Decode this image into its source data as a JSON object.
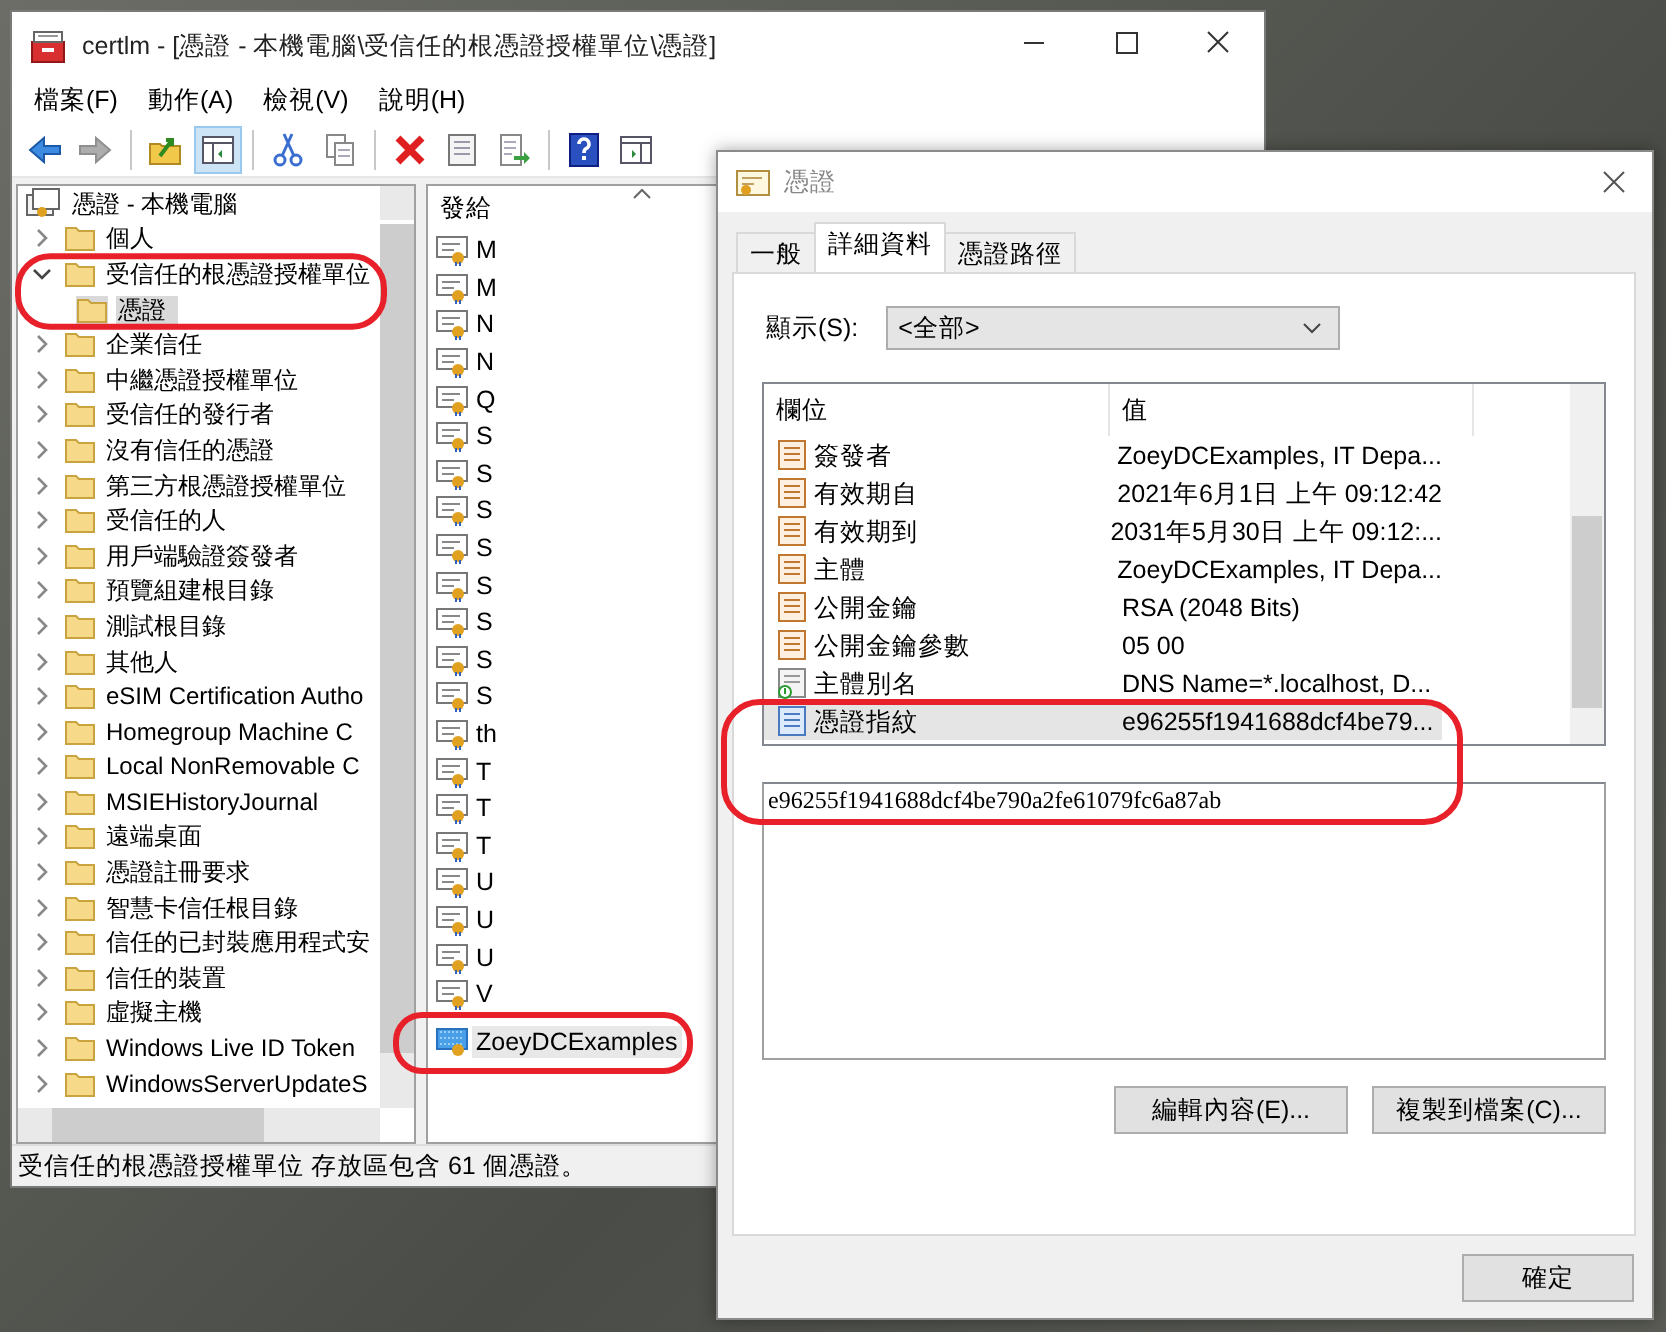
{
  "window": {
    "title": "certlm - [憑證 - 本機電腦\\受信任的根憑證授權單位\\憑證]"
  },
  "menu": [
    "檔案(F)",
    "動作(A)",
    "檢視(V)",
    "說明(H)"
  ],
  "toolbar": {
    "groups": [
      {
        "buttons": [
          {
            "kind": "back",
            "disabled": false,
            "pressed": false
          },
          {
            "kind": "forward",
            "disabled": true,
            "pressed": false
          }
        ]
      },
      {
        "buttons": [
          {
            "kind": "folder-up",
            "disabled": false,
            "pressed": false
          },
          {
            "kind": "console-tree",
            "disabled": false,
            "pressed": true
          }
        ]
      },
      {
        "buttons": [
          {
            "kind": "cut",
            "disabled": false,
            "pressed": false
          },
          {
            "kind": "copy",
            "disabled": false,
            "pressed": false
          }
        ]
      },
      {
        "buttons": [
          {
            "kind": "delete",
            "disabled": false,
            "pressed": false
          },
          {
            "kind": "properties",
            "disabled": false,
            "pressed": false
          },
          {
            "kind": "export",
            "disabled": false,
            "pressed": false
          }
        ]
      },
      {
        "buttons": [
          {
            "kind": "help",
            "disabled": false,
            "pressed": false
          },
          {
            "kind": "action-pane",
            "disabled": false,
            "pressed": false
          }
        ]
      }
    ]
  },
  "tree": {
    "root": "憑證 - 本機電腦",
    "items": [
      {
        "label": "個人",
        "expanded": false,
        "selected": false
      },
      {
        "label": "受信任的根憑證授權單位",
        "expanded": true,
        "selected": false,
        "children": [
          {
            "label": "憑證",
            "selected": true
          }
        ]
      },
      {
        "label": "企業信任",
        "expanded": false,
        "selected": false
      },
      {
        "label": "中繼憑證授權單位",
        "expanded": false,
        "selected": false
      },
      {
        "label": "受信任的發行者",
        "expanded": false,
        "selected": false
      },
      {
        "label": "沒有信任的憑證",
        "expanded": false,
        "selected": false
      },
      {
        "label": "第三方根憑證授權單位",
        "expanded": false,
        "selected": false
      },
      {
        "label": "受信任的人",
        "expanded": false,
        "selected": false
      },
      {
        "label": "用戶端驗證簽發者",
        "expanded": false,
        "selected": false
      },
      {
        "label": "預覽組建根目錄",
        "expanded": false,
        "selected": false
      },
      {
        "label": "測試根目錄",
        "expanded": false,
        "selected": false
      },
      {
        "label": "其他人",
        "expanded": false,
        "selected": false
      },
      {
        "label": "eSIM Certification Autho",
        "expanded": false,
        "selected": false
      },
      {
        "label": "Homegroup Machine C",
        "expanded": false,
        "selected": false
      },
      {
        "label": "Local NonRemovable C",
        "expanded": false,
        "selected": false
      },
      {
        "label": "MSIEHistoryJournal",
        "expanded": false,
        "selected": false
      },
      {
        "label": "遠端桌面",
        "expanded": false,
        "selected": false
      },
      {
        "label": "憑證註冊要求",
        "expanded": false,
        "selected": false
      },
      {
        "label": "智慧卡信任根目錄",
        "expanded": false,
        "selected": false
      },
      {
        "label": "信任的已封裝應用程式安",
        "expanded": false,
        "selected": false
      },
      {
        "label": "信任的裝置",
        "expanded": false,
        "selected": false
      },
      {
        "label": "虛擬主機",
        "expanded": false,
        "selected": false
      },
      {
        "label": "Windows Live ID Token",
        "expanded": false,
        "selected": false
      },
      {
        "label": "WindowsServerUpdateS",
        "expanded": false,
        "selected": false
      }
    ]
  },
  "list": {
    "columns": [
      "發給"
    ],
    "rows": [
      {
        "name": "M",
        "kind": "certificate",
        "selected": false
      },
      {
        "name": "M",
        "kind": "certificate",
        "selected": false
      },
      {
        "name": "N",
        "kind": "certificate",
        "selected": false
      },
      {
        "name": "N",
        "kind": "certificate",
        "selected": false
      },
      {
        "name": "Q",
        "kind": "certificate",
        "selected": false
      },
      {
        "name": "S",
        "kind": "certificate",
        "selected": false
      },
      {
        "name": "S",
        "kind": "certificate",
        "selected": false
      },
      {
        "name": "S",
        "kind": "certificate",
        "selected": false
      },
      {
        "name": "S",
        "kind": "certificate",
        "selected": false
      },
      {
        "name": "S",
        "kind": "certificate",
        "selected": false
      },
      {
        "name": "S",
        "kind": "certificate",
        "selected": false
      },
      {
        "name": "S",
        "kind": "certificate",
        "selected": false
      },
      {
        "name": "S",
        "kind": "certificate",
        "selected": false
      },
      {
        "name": "th",
        "kind": "certificate",
        "selected": false
      },
      {
        "name": "T",
        "kind": "certificate",
        "selected": false
      },
      {
        "name": "T",
        "kind": "certificate",
        "selected": false
      },
      {
        "name": "T",
        "kind": "certificate",
        "selected": false
      },
      {
        "name": "U",
        "kind": "certificate",
        "selected": false
      },
      {
        "name": "U",
        "kind": "certificate",
        "selected": false
      },
      {
        "name": "U",
        "kind": "certificate",
        "selected": false
      },
      {
        "name": "V",
        "kind": "certificate",
        "selected": false
      },
      {
        "name": "ZoeyDCExamples",
        "kind": "highlighted-certificate",
        "selected": true
      }
    ]
  },
  "status_bar": "受信任的根憑證授權單位 存放區包含 61 個憑證。",
  "dialog": {
    "title": "憑證",
    "tabs": [
      {
        "label": "一般",
        "selected": false
      },
      {
        "label": "詳細資料",
        "selected": true
      },
      {
        "label": "憑證路徑",
        "selected": false
      }
    ],
    "show": {
      "label": "顯示(S):",
      "value": "<全部>"
    },
    "fields": {
      "columns": [
        "欄位",
        "值"
      ],
      "rows": [
        {
          "field": "簽發者",
          "value": "ZoeyDCExamples, IT Depa...",
          "kind": "field",
          "selected": false
        },
        {
          "field": "有效期自",
          "value": "2021年6月1日 上午 09:12:42",
          "kind": "field",
          "selected": false
        },
        {
          "field": "有效期到",
          "value": "2031年5月30日 上午 09:12:...",
          "kind": "field",
          "selected": false
        },
        {
          "field": "主體",
          "value": "ZoeyDCExamples, IT Depa...",
          "kind": "field",
          "selected": false
        },
        {
          "field": "公開金鑰",
          "value": "RSA (2048 Bits)",
          "kind": "field",
          "selected": false
        },
        {
          "field": "公開金鑰參數",
          "value": "05 00",
          "kind": "field",
          "selected": false
        },
        {
          "field": "主體別名",
          "value": "DNS Name=*.localhost, D...",
          "kind": "extension",
          "selected": false
        },
        {
          "field": "憑證指紋",
          "value": "e96255f1941688dcf4be79...",
          "kind": "property",
          "selected": true
        }
      ]
    },
    "detail": "e96255f1941688dcf4be790a2fe61079fc6a87ab",
    "buttons": [
      "編輯內容(E)...",
      "複製到檔案(C)..."
    ],
    "ok": "確定"
  }
}
